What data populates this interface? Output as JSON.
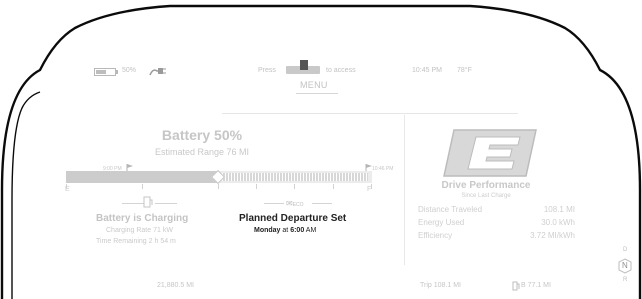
{
  "status_bar": {
    "battery_percent": "50%",
    "press_label": "Press",
    "access_label": "to access",
    "menu_label": "MENU",
    "time": "10:45 PM",
    "temperature": "78°F"
  },
  "battery": {
    "title": "Battery 50%",
    "range": "Estimated Range 76 MI",
    "charge_level": 0.5,
    "start_time": "9:00 PM",
    "end_time": "10:46 PM",
    "empty_label": "E",
    "full_label": "F"
  },
  "charging": {
    "title": "Battery is Charging",
    "rate": "Charging Rate 71 kW",
    "remaining": "Time Remaining 2 h 54 m"
  },
  "departure": {
    "title": "Planned Departure Set",
    "day": "Monday",
    "at": "at",
    "time": "6:00",
    "ampm": "AM",
    "icon_label": "ECO"
  },
  "performance": {
    "title": "Drive Performance",
    "subtitle": "Since Last Charge",
    "rows": [
      {
        "label": "Distance Traveled",
        "value": "108.1 MI"
      },
      {
        "label": "Energy Used",
        "value": "30.0 kWh"
      },
      {
        "label": "Efficiency",
        "value": "3.72 MI/kWh"
      }
    ]
  },
  "bottom": {
    "odometer": "21,880.5 MI",
    "trip": "Trip 108.1 MI",
    "trip_b": "B 77.1 MI"
  },
  "gear": {
    "drive": "D",
    "neutral": "N",
    "reverse": "R"
  }
}
